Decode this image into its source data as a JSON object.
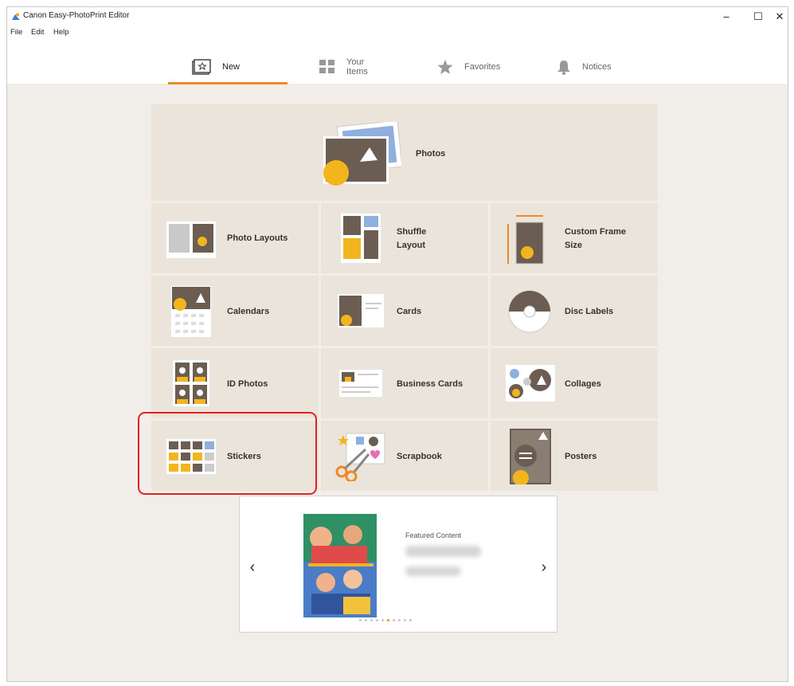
{
  "window": {
    "title": "Canon Easy-PhotoPrint Editor",
    "controls": {
      "minimize": "–",
      "maximize": "☐",
      "close": "✕"
    }
  },
  "menu": {
    "items": [
      "File",
      "Edit",
      "Help"
    ]
  },
  "tabs": [
    {
      "label": "New",
      "icon": "new-icon",
      "active": true
    },
    {
      "label": "Your Items",
      "icon": "grid-icon",
      "active": false
    },
    {
      "label": "Favorites",
      "icon": "star-icon",
      "active": false
    },
    {
      "label": "Notices",
      "icon": "bell-icon",
      "active": false
    }
  ],
  "tiles": {
    "photos": "Photos",
    "photo_layouts": "Photo Layouts",
    "shuffle_layout": "Shuffle\nLayout",
    "custom_frame_size": "Custom Frame\nSize",
    "calendars": "Calendars",
    "cards": "Cards",
    "disc_labels": "Disc Labels",
    "id_photos": "ID Photos",
    "business_cards": "Business Cards",
    "collages": "Collages",
    "stickers": "Stickers",
    "scrapbook": "Scrapbook",
    "posters": "Posters"
  },
  "featured": {
    "label": "Featured Content",
    "prev": "‹",
    "next": "›",
    "dot_count": 10,
    "active_dot": 6
  },
  "colors": {
    "accent": "#f08a24",
    "tile_bg": "#eae4da",
    "window_bg": "#f1eeea",
    "highlight": "#e32121",
    "thumb_dark": "#6b5d52",
    "flower": "#f3b51e"
  }
}
